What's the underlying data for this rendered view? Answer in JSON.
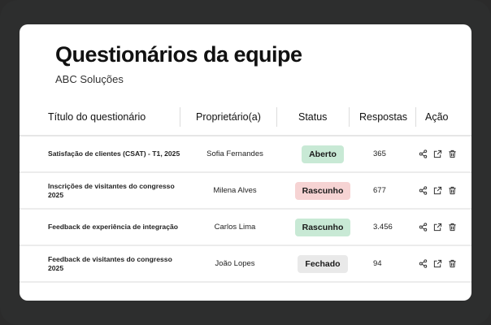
{
  "page": {
    "title": "Questionários da equipe",
    "subtitle": "ABC Soluções"
  },
  "table": {
    "columns": [
      "Título do questionário",
      "Proprietário(a)",
      "Status",
      "Respostas",
      "Ação"
    ],
    "rows": [
      {
        "title": "Satisfação de clientes (CSAT) - T1, 2025",
        "owner": "Sofia Fernandes",
        "status": "Aberto",
        "status_kind": "open",
        "responses": "365"
      },
      {
        "title": "Inscrições de visitantes do congresso 2025",
        "owner": "Milena Alves",
        "status": "Rascunho",
        "status_kind": "draft",
        "responses": "677"
      },
      {
        "title": "Feedback de experiência de integração",
        "owner": "Carlos Lima",
        "status": "Rascunho",
        "status_kind": "open",
        "responses": "3.456"
      },
      {
        "title": "Feedback de visitantes do congresso 2025",
        "owner": "João Lopes",
        "status": "Fechado",
        "status_kind": "closed",
        "responses": "94"
      }
    ]
  },
  "colors": {
    "open": "#c8e9d5",
    "draft": "#f6d3d3",
    "closed": "#e9e9e9",
    "frame": "#2d2e2e"
  },
  "icons": [
    "share-icon",
    "export-icon",
    "trash-icon"
  ]
}
